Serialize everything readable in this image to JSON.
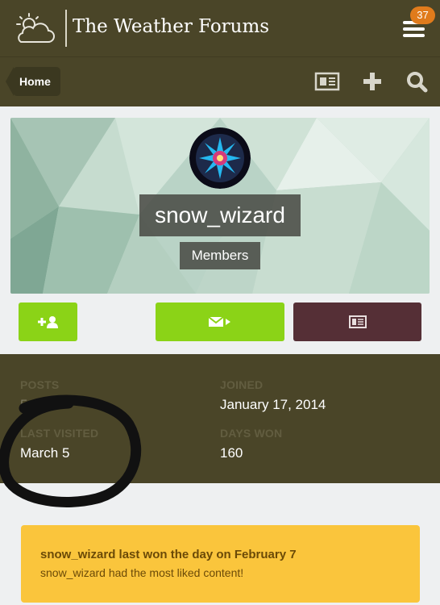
{
  "header": {
    "site_title": "The Weather Forums",
    "notification_count": "37",
    "logo_icon": "sun-behind-cloud-icon",
    "menu_icon": "hamburger-menu-icon"
  },
  "nav": {
    "home_label": "Home",
    "icons": [
      "newspaper-icon",
      "plus-icon",
      "search-icon"
    ]
  },
  "profile": {
    "username": "snow_wizard",
    "group": "Members",
    "avatar_icon": "snowflake-mandala-avatar",
    "buttons": [
      "follow-button",
      "message-button",
      "content-button"
    ],
    "colors": {
      "follow": "#8bd317",
      "message": "#8bd317",
      "content": "#552f36"
    }
  },
  "stats": {
    "posts_label": "POSTS",
    "posts_value": "54093",
    "joined_label": "JOINED",
    "joined_value": "January 17, 2014",
    "last_visited_label": "LAST VISITED",
    "last_visited_value": "March 5",
    "days_won_label": "DAYS WON",
    "days_won_value": "160"
  },
  "notice": {
    "title": "snow_wizard last won the day on February 7",
    "text": "snow_wizard had the most liked content!"
  },
  "colors": {
    "header_bg": "#4a4528",
    "badge": "#e07b1c",
    "notice_bg": "#fac53c"
  }
}
